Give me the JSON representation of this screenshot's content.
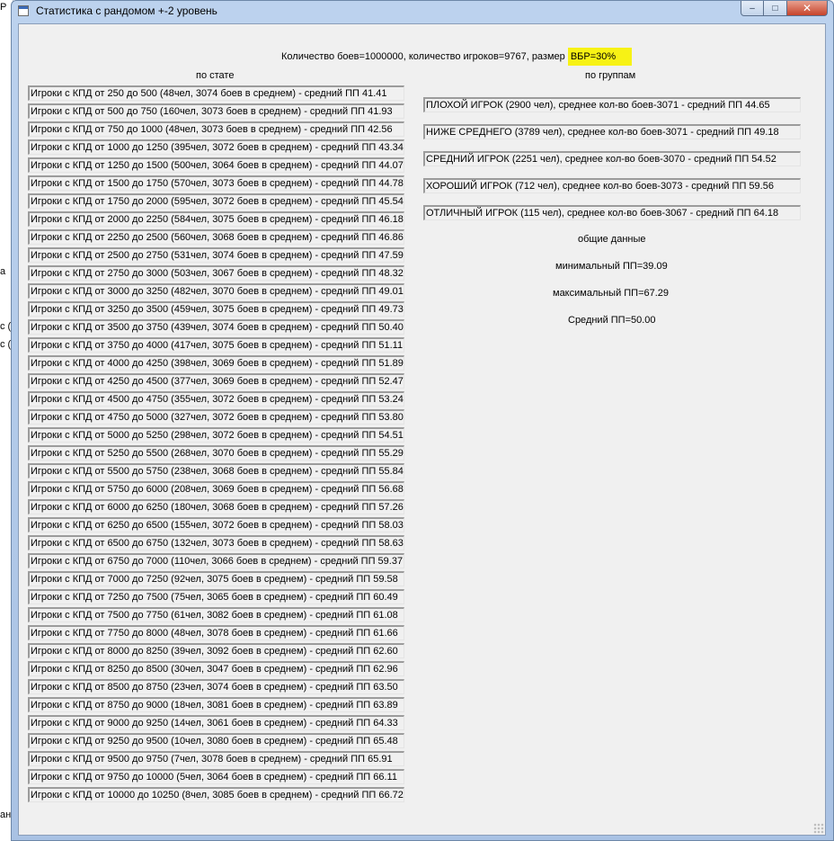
{
  "window": {
    "title": "Статистика с рандомом +-2 уровень",
    "minimize": "–",
    "maximize": "□",
    "close": "✕"
  },
  "background_fragments": [
    "Р",
    "с (",
    "с (",
    "а",
    "ан"
  ],
  "header": {
    "summary": "Количество боев=1000000, количество игроков=9767, размер",
    "highlight": "ВБР=30%",
    "highlight_color": "#f7f215"
  },
  "by_stat": {
    "title": "по стате",
    "rows": [
      "Игроки с КПД от 250 до 500 (48чел, 3074 боев в среднем) - средний ПП 41.41",
      "Игроки с КПД от 500 до 750 (160чел, 3073 боев в среднем) - средний ПП 41.93",
      "Игроки с КПД от 750 до 1000 (48чел, 3073 боев в среднем) - средний ПП 42.56",
      "Игроки с КПД от 1000 до 1250 (395чел, 3072 боев в среднем) - средний ПП 43.34",
      "Игроки с КПД от 1250 до 1500 (500чел, 3064 боев в среднем) - средний ПП 44.07",
      "Игроки с КПД от 1500 до 1750 (570чел, 3073 боев в среднем) - средний ПП 44.78",
      "Игроки с КПД от 1750 до 2000 (595чел, 3072 боев в среднем) - средний ПП 45.54",
      "Игроки с КПД от 2000 до 2250 (584чел, 3075 боев в среднем) - средний ПП 46.18",
      "Игроки с КПД от 2250 до 2500 (560чел, 3068 боев в среднем) - средний ПП 46.86",
      "Игроки с КПД от 2500 до 2750 (531чел, 3074 боев в среднем) - средний ПП 47.59",
      "Игроки с КПД от 2750 до 3000 (503чел, 3067 боев в среднем) - средний ПП 48.32",
      "Игроки с КПД от 3000 до 3250 (482чел, 3070 боев в среднем) - средний ПП 49.01",
      "Игроки с КПД от 3250 до 3500 (459чел, 3075 боев в среднем) - средний ПП 49.73",
      "Игроки с КПД от 3500 до 3750 (439чел, 3074 боев в среднем) - средний ПП 50.40",
      "Игроки с КПД от 3750 до 4000 (417чел, 3075 боев в среднем) - средний ПП 51.11",
      "Игроки с КПД от 4000 до 4250 (398чел, 3069 боев в среднем) - средний ПП 51.89",
      "Игроки с КПД от 4250 до 4500 (377чел, 3069 боев в среднем) - средний ПП 52.47",
      "Игроки с КПД от 4500 до 4750 (355чел, 3072 боев в среднем) - средний ПП 53.24",
      "Игроки с КПД от 4750 до 5000 (327чел, 3072 боев в среднем) - средний ПП 53.80",
      "Игроки с КПД от 5000 до 5250 (298чел, 3072 боев в среднем) - средний ПП 54.51",
      "Игроки с КПД от 5250 до 5500 (268чел, 3070 боев в среднем) - средний ПП 55.29",
      "Игроки с КПД от 5500 до 5750 (238чел, 3068 боев в среднем) - средний ПП 55.84",
      "Игроки с КПД от 5750 до 6000 (208чел, 3069 боев в среднем) - средний ПП 56.68",
      "Игроки с КПД от 6000 до 6250 (180чел, 3068 боев в среднем) - средний ПП 57.26",
      "Игроки с КПД от 6250 до 6500 (155чел, 3072 боев в среднем) - средний ПП 58.03",
      "Игроки с КПД от 6500 до 6750 (132чел, 3073 боев в среднем) - средний ПП 58.63",
      "Игроки с КПД от 6750 до 7000 (110чел, 3066 боев в среднем) - средний ПП 59.37",
      "Игроки с КПД от 7000 до 7250 (92чел, 3075 боев в среднем) - средний ПП 59.58",
      "Игроки с КПД от 7250 до 7500 (75чел, 3065 боев в среднем) - средний ПП 60.49",
      "Игроки с КПД от 7500 до 7750 (61чел, 3082 боев в среднем) - средний ПП 61.08",
      "Игроки с КПД от 7750 до 8000 (48чел, 3078 боев в среднем) - средний ПП 61.66",
      "Игроки с КПД от 8000 до 8250 (39чел, 3092 боев в среднем) - средний ПП 62.60",
      "Игроки с КПД от 8250 до 8500 (30чел, 3047 боев в среднем) - средний ПП 62.96",
      "Игроки с КПД от 8500 до 8750 (23чел, 3074 боев в среднем) - средний ПП 63.50",
      "Игроки с КПД от 8750 до 9000 (18чел, 3081 боев в среднем) - средний ПП 63.89",
      "Игроки с КПД от 9000 до 9250 (14чел, 3061 боев в среднем) - средний ПП 64.33",
      "Игроки с КПД от 9250 до 9500 (10чел, 3080 боев в среднем) - средний ПП 65.48",
      "Игроки с КПД от 9500 до 9750 (7чел, 3078 боев в среднем) - средний ПП 65.91",
      "Игроки с КПД от 9750 до 10000 (5чел, 3064 боев в среднем) - средний ПП 66.11",
      "Игроки с КПД от 10000 до 10250 (8чел, 3085 боев в среднем) - средний ПП 66.72"
    ]
  },
  "by_group": {
    "title": "по группам",
    "rows": [
      "ПЛОХОЙ ИГРОК (2900 чел), среднее кол-во боев-3071 - средний ПП 44.65",
      "НИЖЕ СРЕДНЕГО (3789 чел), среднее кол-во боев-3071 - средний ПП 49.18",
      "СРЕДНИЙ ИГРОК (2251 чел), среднее кол-во боев-3070 - средний ПП 54.52",
      "ХОРОШИЙ ИГРОК (712 чел), среднее кол-во боев-3073 - средний ПП 59.56",
      "ОТЛИЧНЫЙ ИГРОК (115 чел), среднее кол-во боев-3067 - средний ПП 64.18"
    ]
  },
  "general": {
    "title": "общие данные",
    "min": "минимальный ПП=39.09",
    "max": "максимальный ПП=67.29",
    "avg": "Средний ПП=50.00"
  }
}
